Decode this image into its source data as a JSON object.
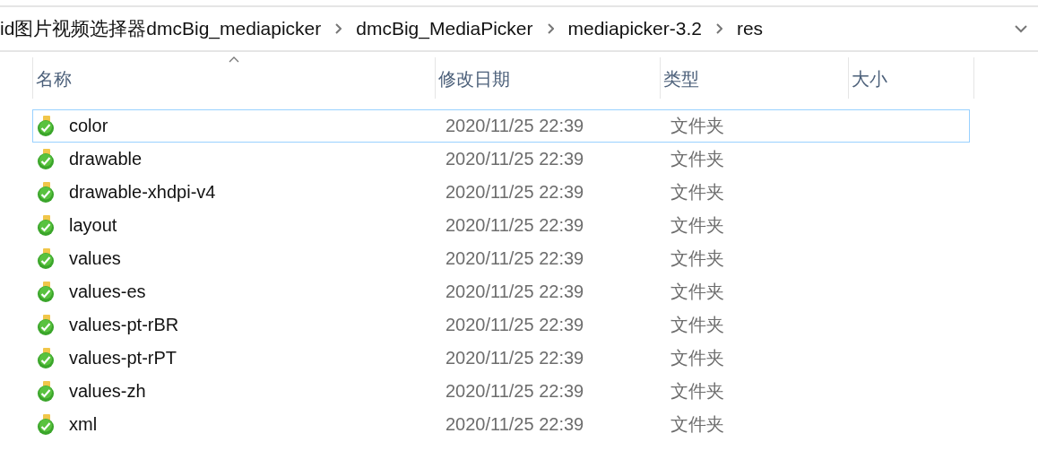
{
  "address_bar": {
    "breadcrumbs": [
      "id图片视频选择器dmcBig_mediapicker",
      "dmcBig_MediaPicker",
      "mediapicker-3.2",
      "res"
    ]
  },
  "table": {
    "columns": [
      {
        "label": "名称",
        "sorted": true
      },
      {
        "label": "修改日期",
        "sorted": false
      },
      {
        "label": "类型",
        "sorted": false
      },
      {
        "label": "大小",
        "sorted": false
      }
    ],
    "rows": [
      {
        "name": "color",
        "modified": "2020/11/25 22:39",
        "type": "文件夹",
        "focused": true
      },
      {
        "name": "drawable",
        "modified": "2020/11/25 22:39",
        "type": "文件夹",
        "focused": false
      },
      {
        "name": "drawable-xhdpi-v4",
        "modified": "2020/11/25 22:39",
        "type": "文件夹",
        "focused": false
      },
      {
        "name": "layout",
        "modified": "2020/11/25 22:39",
        "type": "文件夹",
        "focused": false
      },
      {
        "name": "values",
        "modified": "2020/11/25 22:39",
        "type": "文件夹",
        "focused": false
      },
      {
        "name": "values-es",
        "modified": "2020/11/25 22:39",
        "type": "文件夹",
        "focused": false
      },
      {
        "name": "values-pt-rBR",
        "modified": "2020/11/25 22:39",
        "type": "文件夹",
        "focused": false
      },
      {
        "name": "values-pt-rPT",
        "modified": "2020/11/25 22:39",
        "type": "文件夹",
        "focused": false
      },
      {
        "name": "values-zh",
        "modified": "2020/11/25 22:39",
        "type": "文件夹",
        "focused": false
      },
      {
        "name": "xml",
        "modified": "2020/11/25 22:39",
        "type": "文件夹",
        "focused": false
      }
    ]
  }
}
